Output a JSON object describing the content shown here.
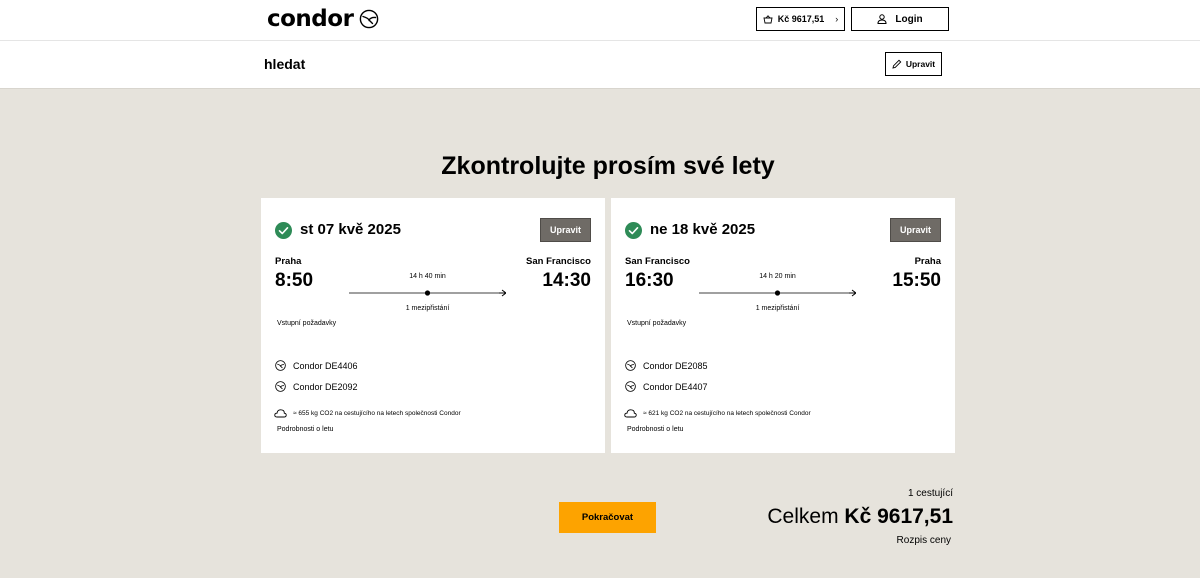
{
  "header": {
    "logo_text": "condor",
    "basket_total": "Kč 9617,51",
    "login_label": "Login"
  },
  "subbar": {
    "title": "hledat",
    "edit_label": "Upravit"
  },
  "page_title": "Zkontrolujte prosím své lety",
  "flights": [
    {
      "date": "st 07 kvě 2025",
      "edit_label": "Upravit",
      "from_city": "Praha",
      "to_city": "San Francisco",
      "depart_time": "8:50",
      "arrive_time": "14:30",
      "duration": "14 h 40 min",
      "stops": "1 mezipřistání",
      "requirements_link": "Vstupní požadavky",
      "segments": [
        "Condor DE4406",
        "Condor DE2092"
      ],
      "co2": "≈ 655 kg CO2 na cestujícího na letech společnosti Condor",
      "details_link": "Podrobnosti o letu"
    },
    {
      "date": "ne 18 kvě 2025",
      "edit_label": "Upravit",
      "from_city": "San Francisco",
      "to_city": "Praha",
      "depart_time": "16:30",
      "arrive_time": "15:50",
      "duration": "14 h 20 min",
      "stops": "1 mezipřistání",
      "requirements_link": "Vstupní požadavky",
      "segments": [
        "Condor DE2085",
        "Condor DE4407"
      ],
      "co2": "≈ 621 kg CO2 na cestujícího na letech společnosti Condor",
      "details_link": "Podrobnosti o letu"
    }
  ],
  "summary": {
    "continue_label": "Pokračovat",
    "passengers": "1 cestující",
    "total_label": "Celkem",
    "total_amount": "Kč 9617,51",
    "breakdown_link": "Rozpis ceny"
  },
  "colors": {
    "background": "#e6e3dc",
    "accent_button": "#fda300",
    "check_green": "#2e8b57",
    "edit_button_gray": "#6f6b66"
  },
  "icons": [
    "condor-logo-icon",
    "basket-icon",
    "user-icon",
    "pencil-icon",
    "check-circle-icon",
    "plane-icon",
    "condor-airline-icon",
    "cloud-icon"
  ]
}
